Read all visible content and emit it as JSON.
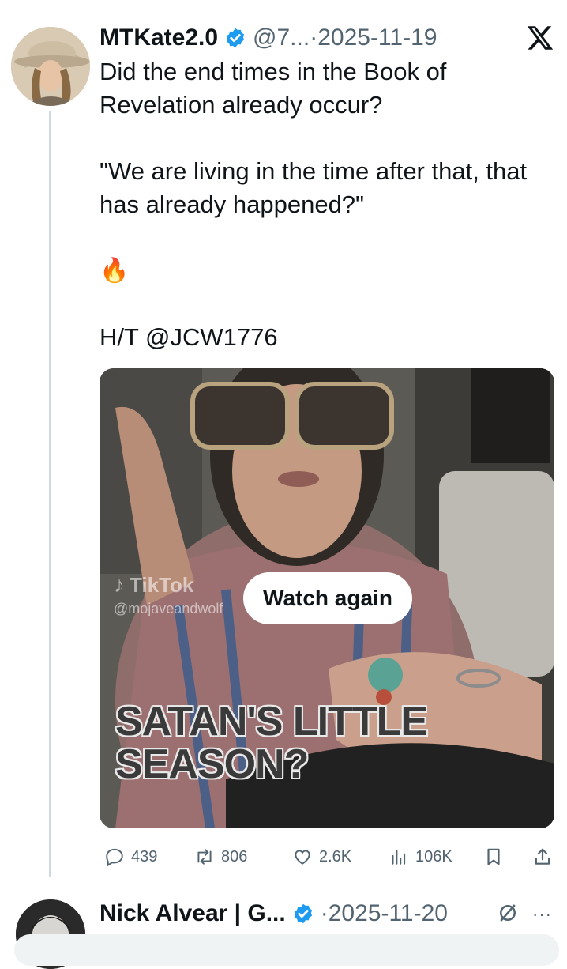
{
  "tweet": {
    "author_name": "MTKate2.0",
    "handle": "@7...",
    "separator": "·",
    "date": "2025-11-19",
    "text_line1": "Did the end times in the Book of Revelation already occur?",
    "text_line2": "\"We are living in the time after that, that has already happened?\"",
    "emoji": "🔥",
    "hat_tip": "H/T @JCW1776",
    "video": {
      "tiktok_brand": "TikTok",
      "tiktok_user": "@mojaveandwolf",
      "watch_again_label": "Watch again",
      "caption_line1": "SATAN'S LITTLE",
      "caption_line2": "SEASON?"
    },
    "stats": {
      "replies": "439",
      "reposts": "806",
      "likes": "2.6K",
      "views": "106K"
    }
  },
  "reply": {
    "author_name": "Nick Alvear | G...",
    "separator": "·",
    "date": "2025-11-20",
    "more": "···"
  },
  "icons": {
    "brand": "x-logo-icon",
    "verified": "verified-badge-icon",
    "reply": "reply-icon",
    "repost": "repost-icon",
    "like": "heart-icon",
    "views": "views-icon",
    "bookmark": "bookmark-icon",
    "share": "share-icon"
  },
  "colors": {
    "verified": "#1d9bf0",
    "muted": "#536471",
    "thread_line": "#cfd9de"
  }
}
